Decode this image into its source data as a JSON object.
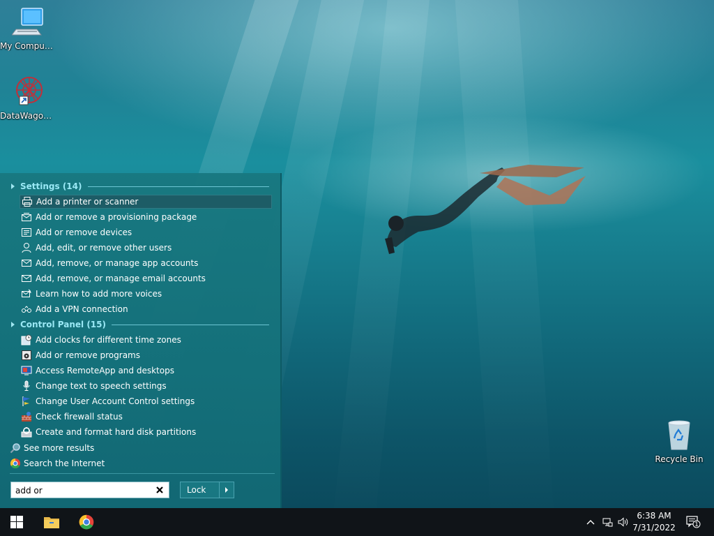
{
  "desktop_icons": [
    {
      "label": "My Computer"
    },
    {
      "label": "DataWagon..."
    },
    {
      "label": "Recycle Bin"
    }
  ],
  "search_panel": {
    "settings_group": {
      "header": "Settings (14)",
      "items": [
        {
          "label": "Add a printer or scanner",
          "icon": "printer-icon"
        },
        {
          "label": "Add or remove a provisioning package",
          "icon": "package-icon"
        },
        {
          "label": "Add or remove devices",
          "icon": "devices-icon"
        },
        {
          "label": "Add, edit, or remove other users",
          "icon": "person-icon"
        },
        {
          "label": "Add, remove, or manage app accounts",
          "icon": "mail-icon"
        },
        {
          "label": "Add, remove, or manage email accounts",
          "icon": "mail-icon"
        },
        {
          "label": "Learn how to add more voices",
          "icon": "voice-icon"
        },
        {
          "label": "Add a VPN connection",
          "icon": "vpn-icon"
        }
      ]
    },
    "control_panel_group": {
      "header": "Control Panel (15)",
      "items": [
        {
          "label": "Add clocks for different time zones",
          "icon": "clock-icon"
        },
        {
          "label": "Add or remove programs",
          "icon": "programs-icon"
        },
        {
          "label": "Access RemoteApp and desktops",
          "icon": "remote-desktop-icon"
        },
        {
          "label": "Change text to speech settings",
          "icon": "microphone-icon"
        },
        {
          "label": "Change User Account Control settings",
          "icon": "flag-icon"
        },
        {
          "label": "Check firewall status",
          "icon": "firewall-icon"
        },
        {
          "label": "Create and format hard disk partitions",
          "icon": "disk-management-icon"
        }
      ]
    },
    "see_more": "See more results",
    "search_internet": "Search the Internet",
    "search_value": "add or",
    "lock_label": "Lock"
  },
  "taskbar": {
    "time": "6:38 AM",
    "date": "7/31/2022",
    "notification_count": "1"
  }
}
